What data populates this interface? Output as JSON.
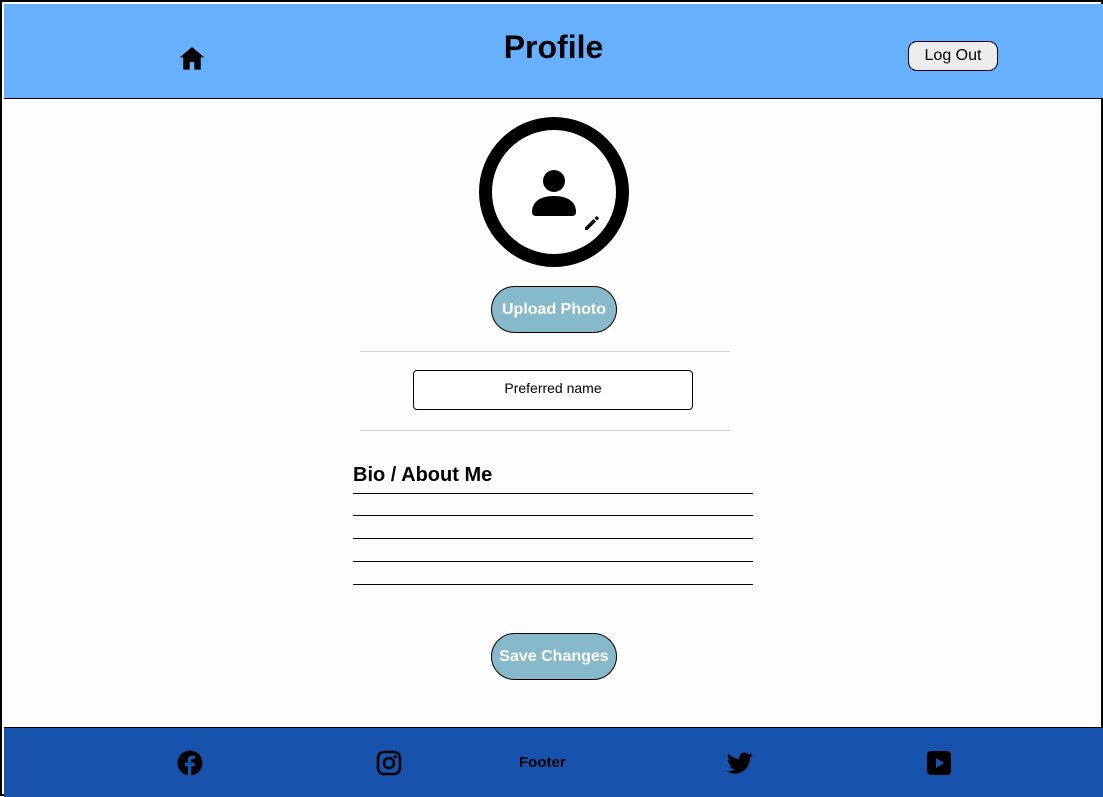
{
  "header": {
    "title": "Profile",
    "home_icon": "home-icon",
    "logout_label": "Log Out"
  },
  "avatar": {
    "icon": "person-icon",
    "edit_icon": "pencil-icon"
  },
  "upload_button_label": "Upload Photo",
  "name_field": {
    "placeholder": "Preferred name",
    "value": ""
  },
  "bio": {
    "label": "Bio / About Me",
    "line_count": 5,
    "value": ""
  },
  "save_button_label": "Save Changes",
  "footer": {
    "label": "Footer",
    "icons": [
      "facebook-icon",
      "instagram-icon",
      "twitter-icon",
      "youtube-icon"
    ]
  },
  "colors": {
    "header_bg": "#66b0fe",
    "footer_bg": "#1753ad",
    "button_bg": "#86b9c9",
    "button_text": "#ffffff"
  }
}
